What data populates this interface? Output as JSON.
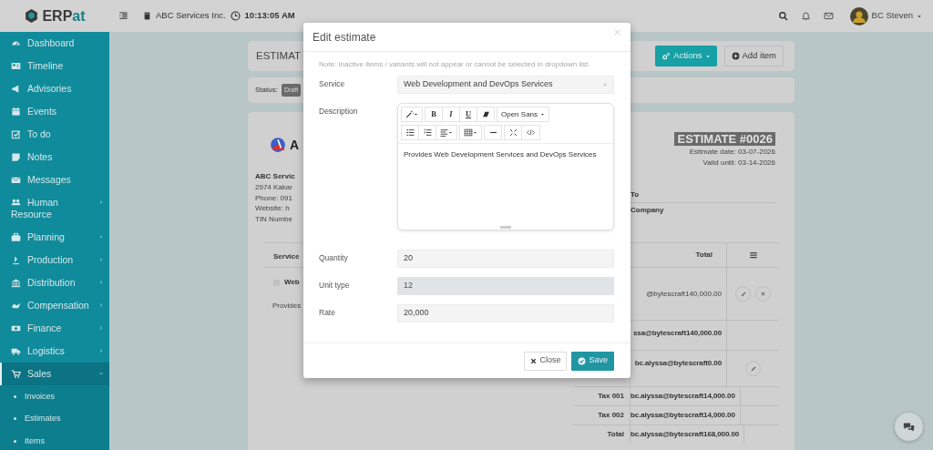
{
  "topbar": {
    "logo": [
      "ERP",
      "at"
    ],
    "company": "ABC Services Inc.",
    "time": "10:13:05 AM",
    "user": "BC Steven"
  },
  "sidebar": {
    "items": [
      {
        "label": "Dashboard",
        "kind": "link",
        "selected": false
      },
      {
        "label": "Timeline",
        "kind": "link",
        "selected": false
      },
      {
        "label": "Advisories",
        "kind": "link",
        "selected": false
      },
      {
        "label": "Events",
        "kind": "link",
        "selected": false
      },
      {
        "label": "To do",
        "kind": "link",
        "selected": false
      },
      {
        "label": "Notes",
        "kind": "link",
        "selected": false
      },
      {
        "label": "Messages",
        "kind": "link",
        "selected": false
      },
      {
        "label": "Human Resource",
        "kind": "group",
        "selected": false,
        "expanded": false
      },
      {
        "label": "Planning",
        "kind": "group",
        "selected": false,
        "expanded": false
      },
      {
        "label": "Production",
        "kind": "group",
        "selected": false,
        "expanded": false
      },
      {
        "label": "Distribution",
        "kind": "group",
        "selected": false,
        "expanded": false
      },
      {
        "label": "Compensation",
        "kind": "group",
        "selected": false,
        "expanded": false
      },
      {
        "label": "Finance",
        "kind": "group",
        "selected": false,
        "expanded": false
      },
      {
        "label": "Logistics",
        "kind": "group",
        "selected": false,
        "expanded": false
      },
      {
        "label": "Sales",
        "kind": "group",
        "selected": true,
        "expanded": true,
        "children": [
          {
            "label": "Invoices",
            "selected": false
          },
          {
            "label": "Estimates",
            "selected": false
          },
          {
            "label": "Items",
            "selected": false
          }
        ]
      }
    ]
  },
  "page": {
    "title": "ESTIMAT",
    "buttons": [
      {
        "label": "Actions",
        "kind": "dropdown"
      },
      {
        "label": "Add item",
        "kind": "add"
      }
    ],
    "status": {
      "label": "Status:",
      "badge": "Draft"
    },
    "estimate": {
      "logo_text": "A",
      "number": "ESTIMATE #0026",
      "date": "Estimate date: 03-07-2026",
      "valid_until": "Valid until: 03-14-2026",
      "company_name": "ABC Servic",
      "company_lines": [
        "2974 Kakar",
        "Phone: 091",
        "Website: h",
        "TIN Numbe"
      ],
      "bill_to": "To",
      "bill_to_name": "Company"
    },
    "table": {
      "columns": [
        "Service",
        "Total"
      ],
      "item": {
        "name": "Web",
        "description": "Provides",
        "total": "@bytescraft140,000.00"
      },
      "summary": [
        {
          "value": "ssa@bytescraft140,000.00",
          "editable": false
        },
        {
          "value": "bc.alyssa@bytescraft0.00",
          "editable": true
        },
        {
          "label": "Tax 001",
          "value": "bc.alyssa@bytescraft14,000.00",
          "editable": false
        },
        {
          "label": "Tax 002",
          "value": "bc.alyssa@bytescraft14,000.00",
          "editable": false
        },
        {
          "label": "Total",
          "value": "bc.alyssa@bytescraft168,000.00",
          "editable": false
        }
      ]
    }
  },
  "modal": {
    "title": "Edit estimate",
    "note": "Note: Inactive items / variants will not appear or cannot be selected in dropdown list.",
    "fields": [
      {
        "label": "Service",
        "kind": "select",
        "value": "Web Development and DevOps Services"
      },
      {
        "label": "Description",
        "kind": "editor",
        "value": "Provides Web Development Services and DevOps Services",
        "toolbar": {
          "text_buttons": [
            "B",
            "I",
            "U"
          ],
          "font": "Open Sans"
        }
      },
      {
        "label": "Quantity",
        "kind": "text",
        "value": "20",
        "disabled": false
      },
      {
        "label": "Unit type",
        "kind": "text",
        "value": "12",
        "disabled": true
      },
      {
        "label": "Rate",
        "kind": "text",
        "value": "20,000",
        "disabled": false
      }
    ],
    "buttons": [
      {
        "label": "Close",
        "kind": "secondary"
      },
      {
        "label": "Save",
        "kind": "primary"
      }
    ]
  }
}
